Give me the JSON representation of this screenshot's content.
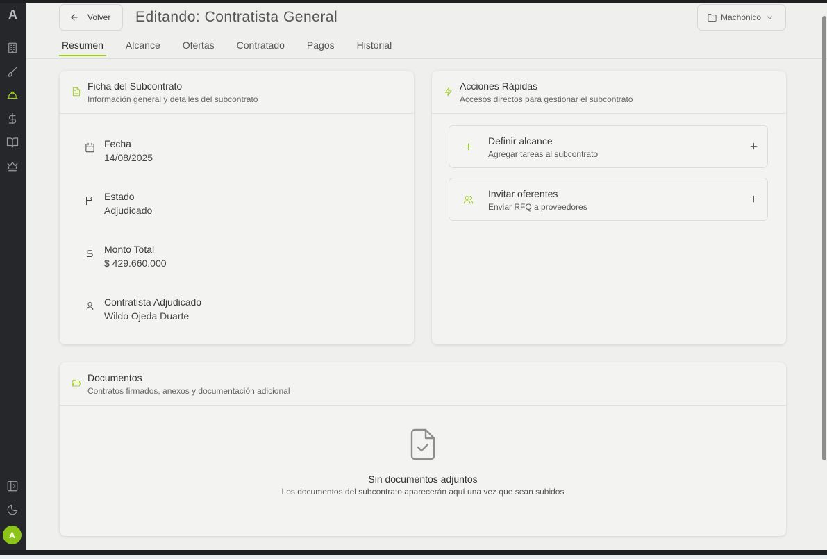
{
  "sidebar": {
    "logo": "A",
    "avatar": "A"
  },
  "header": {
    "back_label": "Volver",
    "title": "Editando: Contratista General",
    "project_label": "Machónico"
  },
  "tabs": [
    {
      "label": "Resumen"
    },
    {
      "label": "Alcance"
    },
    {
      "label": "Ofertas"
    },
    {
      "label": "Contratado"
    },
    {
      "label": "Pagos"
    },
    {
      "label": "Historial"
    }
  ],
  "ficha": {
    "title": "Ficha del Subcontrato",
    "subtitle": "Información general y detalles del subcontrato",
    "fields": [
      {
        "label": "Fecha",
        "value": "14/08/2025",
        "icon": "calendar-icon"
      },
      {
        "label": "Estado",
        "value": "Adjudicado",
        "icon": "flag-icon"
      },
      {
        "label": "Monto Total",
        "value": "$ 429.660.000",
        "icon": "dollar-icon"
      },
      {
        "label": "Contratista Adjudicado",
        "value": "Wildo Ojeda Duarte",
        "icon": "user-icon"
      }
    ]
  },
  "acciones": {
    "title": "Acciones Rápidas",
    "subtitle": "Accesos directos para gestionar el subcontrato",
    "items": [
      {
        "title": "Definir alcance",
        "subtitle": "Agregar tareas al subcontrato",
        "icon": "plus-icon"
      },
      {
        "title": "Invitar oferentes",
        "subtitle": "Enviar RFQ a proveedores",
        "icon": "users-icon"
      }
    ]
  },
  "documentos": {
    "title": "Documentos",
    "subtitle": "Contratos firmados, anexos y documentación adicional",
    "empty_title": "Sin documentos adjuntos",
    "empty_subtitle": "Los documentos del subcontrato aparecerán aquí una vez que sean subidos"
  },
  "colors": {
    "accent": "#9ccc1c",
    "sidebar_bg": "#26272a",
    "page_bg": "#efefed"
  }
}
